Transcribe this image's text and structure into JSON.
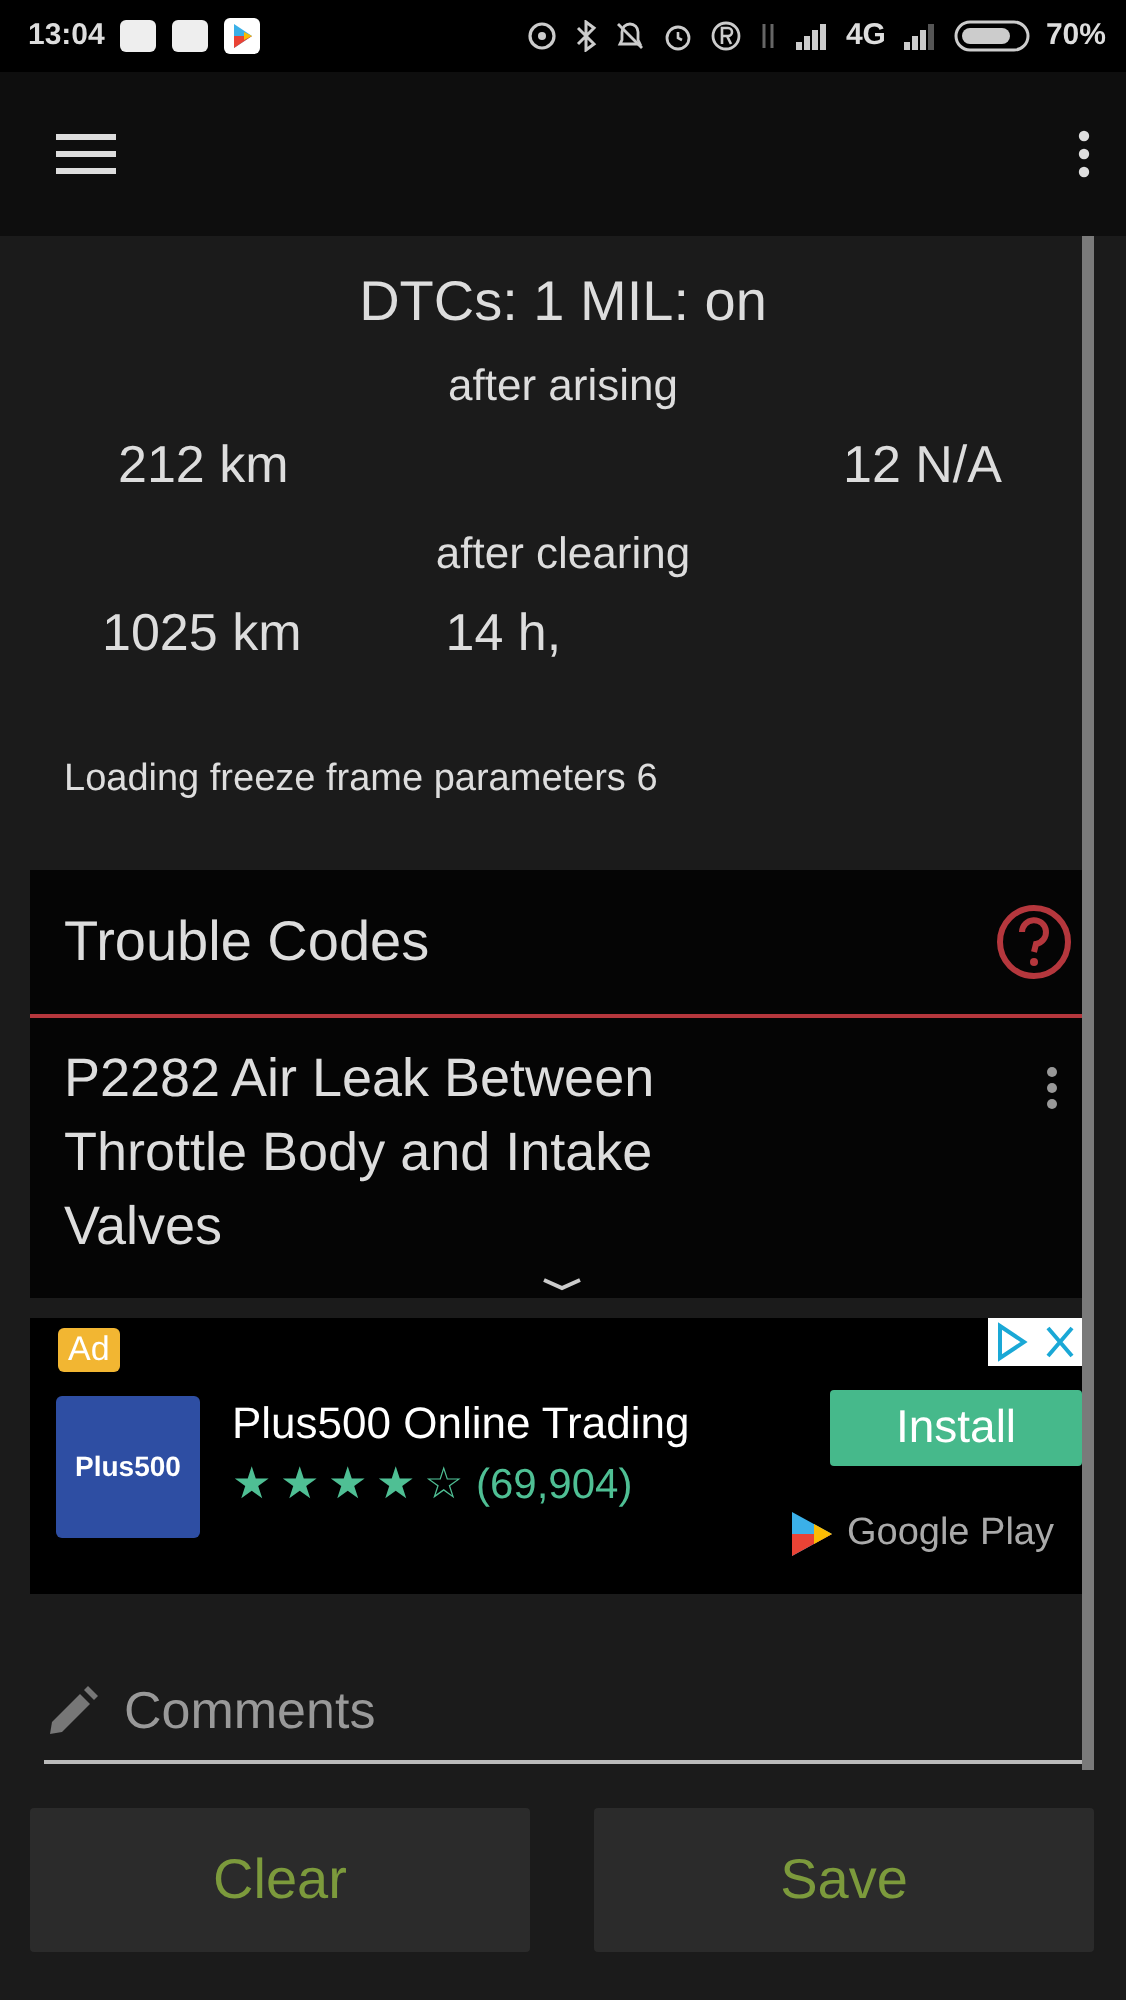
{
  "status_bar": {
    "time": "13:04",
    "network": "4G",
    "battery": "70%"
  },
  "summary": {
    "title": "DTCs: 1 MIL: on",
    "arising_label": "after arising",
    "arising_distance": "212 km",
    "arising_value": "12 N/A",
    "clearing_label": "after clearing",
    "clearing_distance": "1025 km",
    "clearing_time": "14 h,",
    "loading": "Loading freeze frame parameters 6"
  },
  "trouble_codes": {
    "title": "Trouble Codes",
    "items": [
      {
        "code": "P2282",
        "description": "Air Leak Between Throttle Body and Intake Valves"
      }
    ]
  },
  "ad": {
    "badge": "Ad",
    "logo": "Plus500",
    "title": "Plus500 Online Trading",
    "stars": 4,
    "reviews": "(69,904)",
    "button": "Install",
    "store": "Google Play"
  },
  "comments": {
    "placeholder": "Comments"
  },
  "buttons": [
    "Clear",
    "Save"
  ]
}
